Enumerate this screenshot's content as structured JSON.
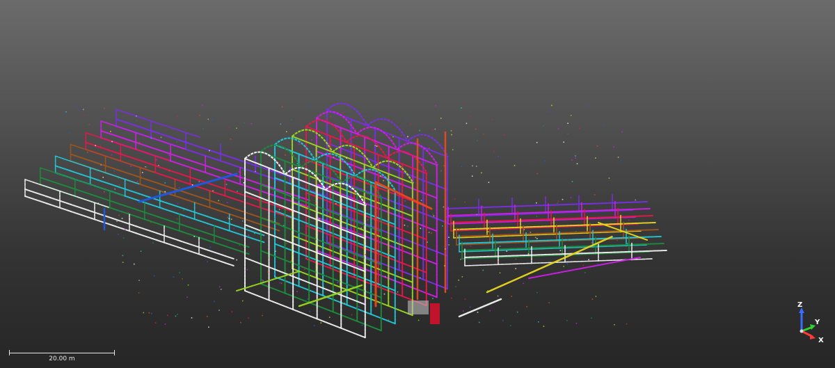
{
  "scale_bar": {
    "label": "20.00 m"
  },
  "axes": {
    "z_label": "Z",
    "y_label": "Y",
    "x_label": "X",
    "z_color": "#3a6cff",
    "y_color": "#2fd02f",
    "x_color": "#ff3a3a"
  },
  "point_cloud": {
    "background_top": "#6b6b6b",
    "background_bottom": "#262626",
    "layer_colors": [
      "#f2f2f2",
      "#1e8c3c",
      "#22c8d8",
      "#a0541e",
      "#e8174a",
      "#d21ee8",
      "#7b2ee8",
      "#1e5ae8",
      "#9ad81e",
      "#e84a1e",
      "#e8d81e",
      "#b4b4b4"
    ]
  }
}
